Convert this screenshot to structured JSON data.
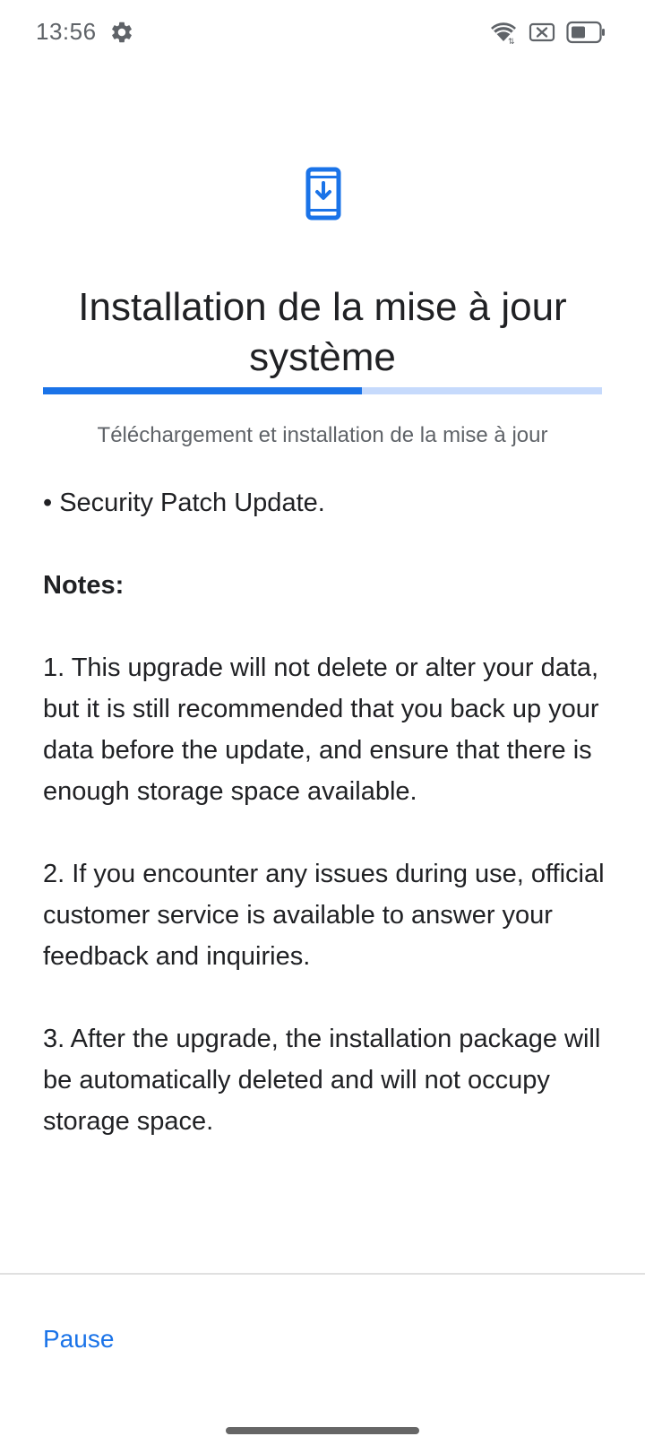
{
  "status_bar": {
    "time": "13:56",
    "icons": [
      "settings-icon",
      "wifi-icon",
      "no-sim-icon",
      "battery-icon"
    ]
  },
  "header": {
    "icon": "system-update-icon",
    "title": "Installation de la mise à jour système"
  },
  "progress": {
    "value": 0.57,
    "label": "Téléchargement et installation de la mise à jour"
  },
  "content": {
    "bullet": "• Security Patch Update.",
    "notes_heading": "Notes:",
    "notes": [
      "1. This upgrade will not delete or alter your data, but it is still recommended that you back up your data before the update, and ensure that there is enough storage space available.",
      "2. If you encounter any issues during use, official customer service is available to answer your feedback and inquiries.",
      "3. After the upgrade, the installation package will be automatically deleted and will not occupy storage space."
    ]
  },
  "footer": {
    "pause_label": "Pause"
  },
  "colors": {
    "accent": "#1a73e8",
    "progress_track": "#c6dafc",
    "secondary_text": "#5f6368"
  }
}
